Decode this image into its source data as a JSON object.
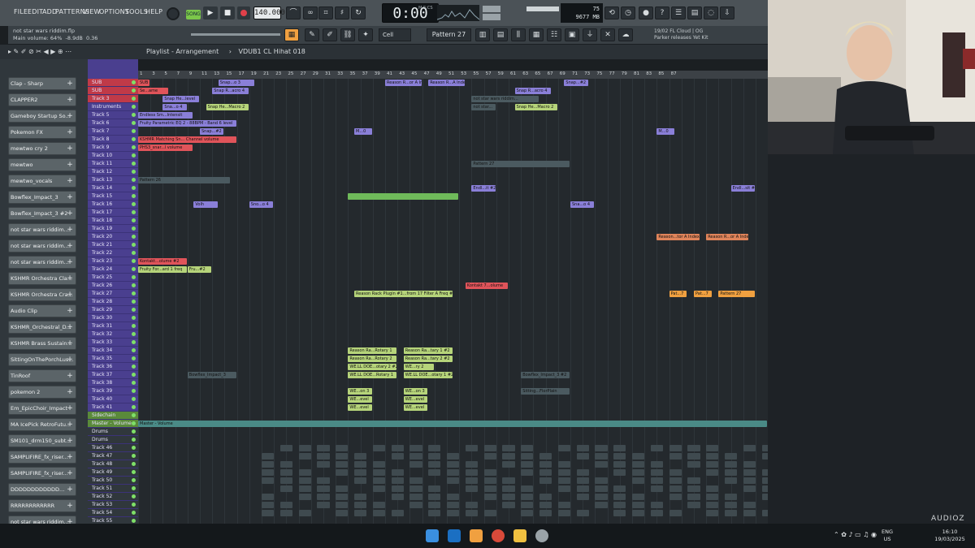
{
  "menu": [
    "FILE",
    "EDIT",
    "ADD",
    "PATTERNS",
    "VIEW",
    "OPTIONS",
    "TOOLS",
    "HELP"
  ],
  "transport": {
    "song_label": "SONG",
    "bpm": "140.000",
    "time": "0:00",
    "time_sub": "M:S:CS"
  },
  "cpu_mem": {
    "cpu": "75",
    "mem": "9677 MB",
    "poly": "13"
  },
  "project": {
    "title": "not star wars riddim.flp",
    "main_volume": "Main volume: 64%",
    "gain": "-8.9dB",
    "value": "0.36"
  },
  "hint": {
    "line1": "19/02  FL Cloud | OG",
    "line2": "Parker releases Yet Kit"
  },
  "pattern_selector": "Pattern 27",
  "snap": "Cell",
  "playlist": {
    "title": "Playlist - Arrangement",
    "crumb": "VDUB1 CL Hihat 018"
  },
  "channels": [
    "Clap - Sharp",
    "CLAPPER2",
    "Gameboy Startup So...",
    "Pokemon FX",
    "mewtwo cry 2",
    "mewtwo",
    "mewtwo_vocals",
    "Bowflex_Impact_3",
    "Bowflex_Impact_3 #2",
    "not star wars riddim...",
    "not star wars riddim...",
    "not star wars riddim...",
    "KSHMR Orchestra Cla...",
    "KSHMR Orchestra Cra...",
    "Audio Clip",
    "KSHMR_Orchestral_D...",
    "KSHMR Brass Sustain...",
    "SittingOnThePorchLus...",
    "TinRoof",
    "pokemon 2",
    "Em_EpicChoir_Impact",
    "MA IcePick RetroFutu...",
    "SM101_drm150_subt...",
    "SAMPLIFIRE_fx_riser...",
    "SAMPLIFIRE_fx_riser...",
    "DDDDDDDDDDDD...",
    "RRRRRRRRRRRR",
    "not star wars riddim..."
  ],
  "tracks": [
    "SUB",
    "SUB",
    "Track 3",
    "Instruments",
    "Track 5",
    "Track 6",
    "Track 7",
    "Track 8",
    "Track 9",
    "Track 10",
    "Track 11",
    "Track 12",
    "Track 13",
    "Track 14",
    "Track 15",
    "Track 16",
    "Track 17",
    "Track 18",
    "Track 19",
    "Track 20",
    "Track 21",
    "Track 22",
    "Track 23",
    "Track 24",
    "Track 25",
    "Track 26",
    "Track 27",
    "Track 28",
    "Track 29",
    "Track 30",
    "Track 31",
    "Track 32",
    "Track 33",
    "Track 34",
    "Track 35",
    "Track 36",
    "Track 37",
    "Track 38",
    "Track 39",
    "Track 40",
    "Track 41",
    "Sidechain",
    "Master - Volume",
    "Drums",
    "Drums",
    "Track 46",
    "Track 47",
    "Track 48",
    "Track 49",
    "Track 50",
    "Track 51",
    "Track 52",
    "Track 53",
    "Track 54",
    "Track 55"
  ],
  "ruler": [
    "1",
    "3",
    "5",
    "7",
    "9",
    "11",
    "13",
    "15",
    "17",
    "19",
    "21",
    "23",
    "25",
    "27",
    "29",
    "31",
    "33",
    "35",
    "37",
    "39",
    "41",
    "43",
    "45",
    "47",
    "49",
    "51",
    "53",
    "55",
    "57",
    "59",
    "61",
    "63",
    "65",
    "67",
    "69",
    "71",
    "73",
    "75",
    "77",
    "79",
    "81",
    "83",
    "85",
    "87"
  ],
  "clips": [
    {
      "track": 0,
      "label": "SUB",
      "start": 1,
      "len": 2,
      "color": "#e0545a"
    },
    {
      "track": 0,
      "label": "Snap...o 3",
      "start": 14,
      "len": 6,
      "color": "#8a7fd8"
    },
    {
      "track": 0,
      "label": "Reason R...or A Index",
      "start": 41,
      "len": 6,
      "color": "#8a7fd8"
    },
    {
      "track": 0,
      "label": "Reason R...A Index #2",
      "start": 48,
      "len": 6,
      "color": "#8a7fd8"
    },
    {
      "track": 0,
      "label": "Snap...#2",
      "start": 70,
      "len": 4,
      "color": "#8a7fd8"
    },
    {
      "track": 1,
      "label": "Se...ame",
      "start": 1,
      "len": 5,
      "color": "#e0545a"
    },
    {
      "track": 1,
      "label": "Snap R...acro 4",
      "start": 13,
      "len": 6,
      "color": "#8a7fd8"
    },
    {
      "track": 1,
      "label": "Snap R...acro 4",
      "start": 62,
      "len": 6,
      "color": "#8a7fd8"
    },
    {
      "track": 2,
      "label": "Snap He...level",
      "start": 5,
      "len": 6,
      "color": "#8a7fd8"
    },
    {
      "track": 2,
      "label": "not star wars riddim...",
      "start": 55,
      "len": 11,
      "color": "#4b5a60"
    },
    {
      "track": 3,
      "label": "Sna...o 4",
      "start": 5,
      "len": 4,
      "color": "#8a7fd8"
    },
    {
      "track": 3,
      "label": "Snap He...Macro 2",
      "start": 12,
      "len": 7,
      "color": "#b6d47a"
    },
    {
      "track": 3,
      "label": "not star...",
      "start": 55,
      "len": 4,
      "color": "#4b5a60"
    },
    {
      "track": 3,
      "label": "Snap He...Macro 2",
      "start": 62,
      "len": 7,
      "color": "#b6d47a"
    },
    {
      "track": 4,
      "label": "Endless Sm...Intensit",
      "start": 1,
      "len": 9,
      "color": "#8a7fd8"
    },
    {
      "track": 5,
      "label": "Fruity Parametric EQ 2 - 88BPM - Band 6 level",
      "start": 1,
      "len": 16,
      "color": "#8a7fd8"
    },
    {
      "track": 6,
      "label": "Snap...#2",
      "start": 11,
      "len": 4,
      "color": "#8a7fd8"
    },
    {
      "track": 6,
      "label": "M...0",
      "start": 36,
      "len": 3,
      "color": "#8a7fd8"
    },
    {
      "track": 6,
      "label": "M...0",
      "start": 85,
      "len": 3,
      "color": "#8a7fd8"
    },
    {
      "track": 7,
      "label": "KSHMR Matching Sn... Channel volume",
      "start": 1,
      "len": 16,
      "color": "#e0545a"
    },
    {
      "track": 8,
      "label": "PHS3_snar...l volume",
      "start": 1,
      "len": 9,
      "color": "#e0545a"
    },
    {
      "track": 10,
      "label": "Pattern 27",
      "start": 55,
      "len": 16,
      "color": "#4b5a60"
    },
    {
      "track": 12,
      "label": "Pattern 26",
      "start": 1,
      "len": 15,
      "color": "#4b5a60"
    },
    {
      "track": 13,
      "label": "Endl...it #2",
      "start": 55,
      "len": 4,
      "color": "#8a7fd8"
    },
    {
      "track": 13,
      "label": "Endl...sit #4",
      "start": 97,
      "len": 4,
      "color": "#8a7fd8"
    },
    {
      "track": 14,
      "label": "",
      "start": 35,
      "len": 18,
      "color": "#6fba5a"
    },
    {
      "track": 15,
      "label": "Volh",
      "start": 10,
      "len": 4,
      "color": "#8a7fd8"
    },
    {
      "track": 15,
      "label": "Sno...o 4",
      "start": 19,
      "len": 4,
      "color": "#8a7fd8"
    },
    {
      "track": 15,
      "label": "Sna...o 4",
      "start": 71,
      "len": 4,
      "color": "#8a7fd8"
    },
    {
      "track": 19,
      "label": "Reason...tor A Index",
      "start": 85,
      "len": 7,
      "color": "#e0845a"
    },
    {
      "track": 19,
      "label": "Reason R...or A Index #2",
      "start": 93,
      "len": 7,
      "color": "#e0845a"
    },
    {
      "track": 22,
      "label": "Kontakt...olume #2",
      "start": 1,
      "len": 8,
      "color": "#e0545a"
    },
    {
      "track": 23,
      "label": "Fruity For...ard 1 freq",
      "start": 1,
      "len": 8,
      "color": "#b6d47a"
    },
    {
      "track": 23,
      "label": "Fru...#2",
      "start": 9,
      "len": 4,
      "color": "#b6d47a"
    },
    {
      "track": 25,
      "label": "Kontakt 7...olume",
      "start": 54,
      "len": 7,
      "color": "#e0545a"
    },
    {
      "track": 26,
      "label": "Reason Rack Plugin #1...from 17 Filter A Freq #2",
      "start": 36,
      "len": 16,
      "color": "#b6d47a"
    },
    {
      "track": 26,
      "label": "Pat...7",
      "start": 87,
      "len": 3,
      "color": "#f0a040"
    },
    {
      "track": 26,
      "label": "Pat...7",
      "start": 91,
      "len": 3,
      "color": "#f0a040"
    },
    {
      "track": 26,
      "label": "Pattern 27",
      "start": 95,
      "len": 6,
      "color": "#f0a040"
    },
    {
      "track": 33,
      "label": "Reason Ra...Rotary 1",
      "start": 35,
      "len": 8,
      "color": "#b6d47a"
    },
    {
      "track": 33,
      "label": "Reason Ra...tary 1 #2",
      "start": 44,
      "len": 8,
      "color": "#b6d47a"
    },
    {
      "track": 34,
      "label": "Reason Ra...Rotary 2",
      "start": 35,
      "len": 8,
      "color": "#b6d47a"
    },
    {
      "track": 34,
      "label": "Reason Ra...tary 2 #2",
      "start": 44,
      "len": 8,
      "color": "#b6d47a"
    },
    {
      "track": 35,
      "label": "WE.LL DOE...otary 2 #2",
      "start": 35,
      "len": 8,
      "color": "#b6d47a"
    },
    {
      "track": 35,
      "label": "WE...ry 2",
      "start": 44,
      "len": 5,
      "color": "#b6d47a"
    },
    {
      "track": 36,
      "label": "Bowflex_Impact_3",
      "start": 9,
      "len": 8,
      "color": "#4b5a60"
    },
    {
      "track": 36,
      "label": "WE.LL DOE...Rotary 1",
      "start": 35,
      "len": 8,
      "color": "#b6d47a"
    },
    {
      "track": 36,
      "label": "WE.LL DOE...otary 1 #2",
      "start": 44,
      "len": 8,
      "color": "#b6d47a"
    },
    {
      "track": 36,
      "label": "Bowflex_Impact_3 #2",
      "start": 63,
      "len": 8,
      "color": "#4b5a60"
    },
    {
      "track": 38,
      "label": "WE...on 3",
      "start": 35,
      "len": 4,
      "color": "#b6d47a"
    },
    {
      "track": 38,
      "label": "WE...on 3",
      "start": 44,
      "len": 4,
      "color": "#b6d47a"
    },
    {
      "track": 38,
      "label": "Sitting...FlorPlain",
      "start": 63,
      "len": 8,
      "color": "#4b5a60"
    },
    {
      "track": 39,
      "label": "WE...evel",
      "start": 35,
      "len": 4,
      "color": "#b6d47a"
    },
    {
      "track": 39,
      "label": "WE...evel",
      "start": 44,
      "len": 4,
      "color": "#b6d47a"
    },
    {
      "track": 40,
      "label": "WE...evel",
      "start": 35,
      "len": 4,
      "color": "#b6d47a"
    },
    {
      "track": 40,
      "label": "WE...evel",
      "start": 44,
      "len": 4,
      "color": "#b6d47a"
    },
    {
      "track": 42,
      "label": "Master - Volume",
      "start": 1,
      "len": 102,
      "color": "#4a8a86"
    }
  ],
  "tray": {
    "lang": "ENG",
    "region": "US",
    "time": "16:10",
    "date": "19/03/2025"
  },
  "watermark": "AUDIOZ",
  "colors": {
    "accent": "#f0a040",
    "tracks_header": "#4a3f8f",
    "clip_purple": "#8a7fd8",
    "clip_green": "#b6d47a",
    "clip_red": "#e0545a"
  }
}
